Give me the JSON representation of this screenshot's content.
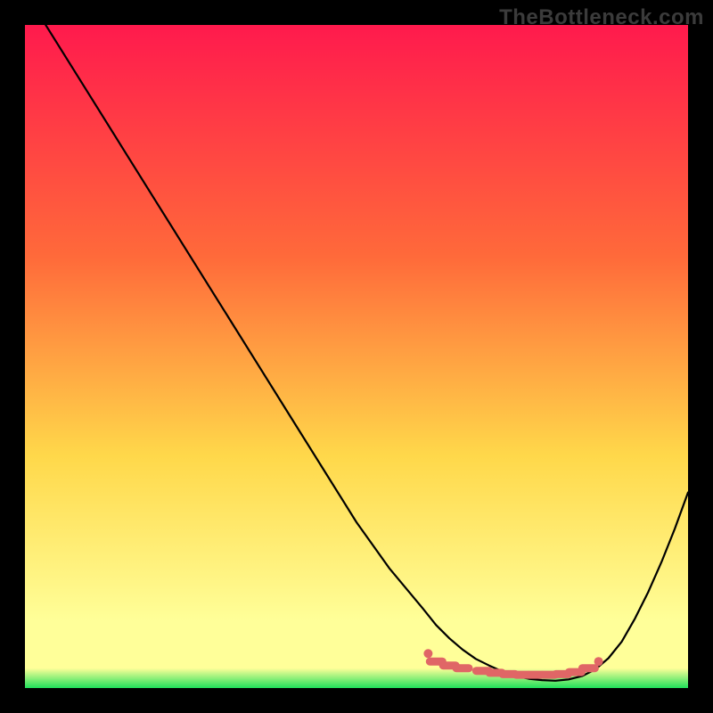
{
  "watermark": "TheBottleneck.com",
  "colors": {
    "frame": "#000000",
    "gradient_top": "#ff1a4d",
    "gradient_mid1": "#ff6a3a",
    "gradient_mid2": "#ffd84a",
    "gradient_bottom_yellow": "#ffff99",
    "gradient_bottom_green": "#1fe05a",
    "curve": "#000000",
    "marker": "#e06666"
  },
  "chart_data": {
    "type": "line",
    "title": "",
    "xlabel": "",
    "ylabel": "",
    "xlim": [
      0,
      100
    ],
    "ylim": [
      0,
      100
    ],
    "series": [
      {
        "name": "bottleneck-curve",
        "x": [
          0,
          5,
          10,
          15,
          20,
          25,
          30,
          35,
          40,
          45,
          50,
          55,
          60,
          62,
          64,
          66,
          68,
          70,
          72,
          74,
          76,
          78,
          80,
          82,
          84,
          86,
          88,
          90,
          92,
          94,
          96,
          98,
          100
        ],
        "y": [
          105,
          97,
          89,
          81,
          73,
          65,
          57,
          49,
          41,
          33,
          25,
          18,
          12,
          9.5,
          7.5,
          5.8,
          4.4,
          3.4,
          2.5,
          1.8,
          1.4,
          1.2,
          1.1,
          1.3,
          1.8,
          2.8,
          4.5,
          7.0,
          10.5,
          14.5,
          19.0,
          24.0,
          29.5
        ]
      }
    ],
    "annotations": [
      {
        "name": "optimal-zone-markers",
        "type": "points",
        "x": [
          62,
          64,
          66,
          69,
          71,
          73,
          75,
          77,
          79,
          81,
          83,
          85
        ],
        "y": [
          4.0,
          3.4,
          3.0,
          2.6,
          2.3,
          2.1,
          2.0,
          2.0,
          2.0,
          2.1,
          2.4,
          3.0
        ]
      }
    ],
    "optimal_x_range": [
      62,
      85
    ]
  }
}
